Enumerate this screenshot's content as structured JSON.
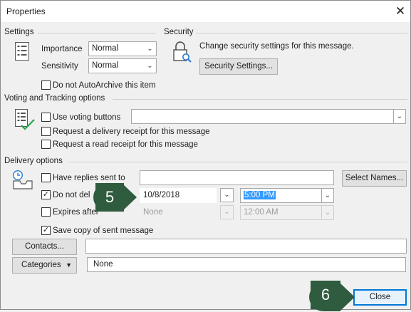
{
  "window": {
    "title": "Properties"
  },
  "settings": {
    "header": "Settings",
    "importance_label": "Importance",
    "importance_value": "Normal",
    "sensitivity_label": "Sensitivity",
    "sensitivity_value": "Normal",
    "autoarchive_label": "Do not AutoArchive this item",
    "autoarchive_checked": false
  },
  "security": {
    "header": "Security",
    "description": "Change security settings for this message.",
    "button_label": "Security Settings..."
  },
  "voting": {
    "header": "Voting and Tracking options",
    "use_voting_label": "Use voting buttons",
    "use_voting_checked": false,
    "voting_value": "",
    "delivery_receipt_label": "Request a delivery receipt for this message",
    "delivery_receipt_checked": false,
    "read_receipt_label": "Request a read receipt for this message",
    "read_receipt_checked": false
  },
  "delivery": {
    "header": "Delivery options",
    "replies_label": "Have replies sent to",
    "replies_checked": false,
    "replies_value": "",
    "select_names_label": "Select Names...",
    "do_not_deliver_label": "Do not del",
    "do_not_deliver_checked": true,
    "do_not_deliver_date": "10/8/2018",
    "do_not_deliver_time": "5:00 PM",
    "expires_label": "Expires after",
    "expires_checked": false,
    "expires_date": "None",
    "expires_time": "12:00 AM",
    "save_copy_label": "Save copy of sent message",
    "save_copy_checked": true
  },
  "contacts": {
    "button_label": "Contacts...",
    "value": ""
  },
  "categories": {
    "button_label": "Categories",
    "value": "None"
  },
  "footer": {
    "close_label": "Close"
  },
  "callouts": {
    "step_5": "5",
    "step_6": "6"
  },
  "colors": {
    "callout_bg": "#2f5b3f",
    "primary_border": "#0078d7",
    "selection": "#3399ff",
    "check_green": "#2aa24a"
  },
  "icons": {
    "properties": "properties-list-icon",
    "security": "lock-key-icon",
    "voting": "checklist-icon",
    "delivery": "inbox-clock-icon"
  }
}
